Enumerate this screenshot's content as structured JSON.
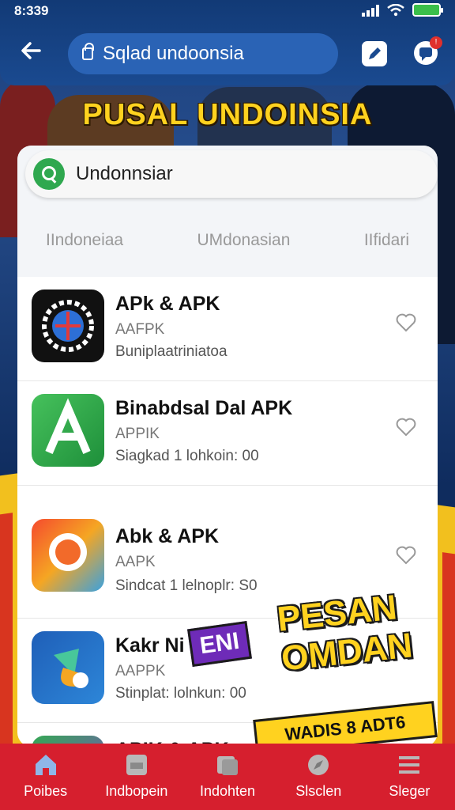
{
  "status": {
    "time": "8:339"
  },
  "header": {
    "address": "Sqlad undoonsia",
    "banner_title": "PUSAL UNDOINSIA"
  },
  "search": {
    "value": "Undonnsiar"
  },
  "tabs": [
    "IIndoneiaa",
    "UMdonasian",
    "IIfidari"
  ],
  "apps": [
    {
      "name": "APk & APK",
      "sub": "AAFPK",
      "meta": "Buniplaatriniatoa",
      "icon": "gear-globe-icon"
    },
    {
      "name": "Binabdsal Dal APK",
      "sub": "APPIK",
      "meta": "Siagkad 1 lohkoin: 00",
      "icon": "letter-a-icon"
    },
    {
      "name": "Abk & APK",
      "sub": "AAPK",
      "meta": "Sindcat 1 lelnoplr: S0",
      "icon": "orange-ring-icon"
    },
    {
      "name": "Kakr Ni",
      "sub": "AAPPK",
      "meta": "Stinplat: lolnkun: 00",
      "icon": "paint-drop-icon"
    },
    {
      "name": "APIK & APK",
      "sub": "",
      "meta": "",
      "icon": "purple-app-icon"
    }
  ],
  "promo": {
    "line1": "PESAN",
    "line2": "OMDAN",
    "tag": "ENI",
    "ribbon": "WADIS 8 ADT6"
  },
  "bottom_nav": [
    {
      "label": "Poibes",
      "icon": "home-icon"
    },
    {
      "label": "Indbopein",
      "icon": "store-icon"
    },
    {
      "label": "Indohten",
      "icon": "library-icon"
    },
    {
      "label": "Slsclen",
      "icon": "compass-icon"
    },
    {
      "label": "Sleger",
      "icon": "menu-icon"
    }
  ],
  "colors": {
    "header": "#1a4a90",
    "nav": "#d61f2e",
    "accent": "#ffd21f"
  }
}
